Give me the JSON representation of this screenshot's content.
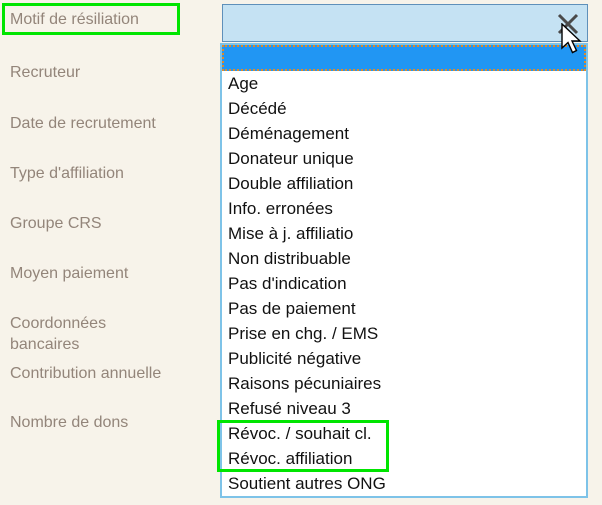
{
  "window": {
    "background_color": "#f7f3ea",
    "annotation_color": "#00e500"
  },
  "form": {
    "labels": [
      {
        "text": "Motif de résiliation",
        "highlighted": true
      },
      {
        "text": "Recruteur",
        "highlighted": false
      },
      {
        "text": "Date de recrutement",
        "highlighted": false
      },
      {
        "text": "Type d'affiliation",
        "highlighted": false
      },
      {
        "text": "Groupe CRS",
        "highlighted": false
      },
      {
        "text": "Moyen paiement",
        "highlighted": false
      },
      {
        "text": "Coordonnées",
        "highlighted": false
      },
      {
        "text": "bancaires",
        "highlighted": false
      },
      {
        "text": "Contribution annuelle",
        "highlighted": false
      },
      {
        "text": "Nombre de dons",
        "highlighted": false
      }
    ]
  },
  "combobox": {
    "value": "",
    "placeholder": "",
    "clear_icon": "close-x-icon",
    "background_color": "#c5e2f3",
    "border_color": "#5f90ba"
  },
  "dropdown": {
    "border_color": "#7ec3e8",
    "selected_index": 0,
    "selected_color": "#2196f3",
    "focus_outline_color": "#e08a2a",
    "options": [
      "",
      "Age",
      "Décédé",
      "Déménagement",
      "Donateur unique",
      "Double affiliation",
      "Info. erronées",
      "Mise à j. affiliatio",
      "Non distribuable",
      "Pas d'indication",
      "Pas de paiement",
      "Prise en chg. / EMS",
      "Publicité négative",
      "Raisons pécuniaires",
      "Refusé niveau 3",
      "Révoc. / souhait cl.",
      "Révoc. affiliation",
      "Soutient autres ONG"
    ],
    "highlighted_options": [
      "Révoc. / souhait cl.",
      "Révoc. affiliation"
    ]
  },
  "cursor": {
    "icon": "mouse-pointer-icon"
  }
}
